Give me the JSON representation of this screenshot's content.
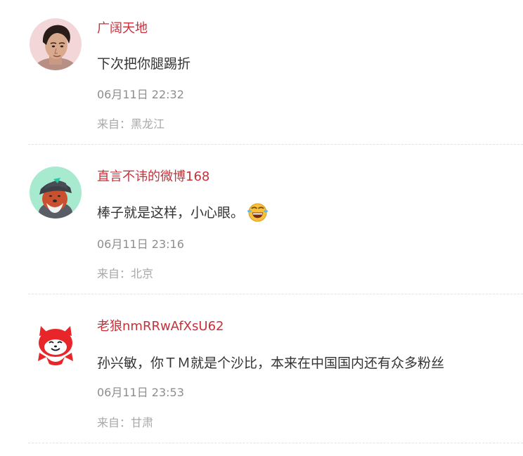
{
  "colors": {
    "username": "#c8303a",
    "content": "#333333",
    "timestamp": "#8d8d8d",
    "location": "#a8a8a8",
    "divider": "#e3e3e3"
  },
  "comments": [
    {
      "username": "广阔天地",
      "content": "下次把你腿踢折",
      "timestamp": "06月11日 22:32",
      "location": "来自：黑龙江",
      "avatar_icon": "male-portrait-avatar"
    },
    {
      "username": "直言不讳的微博168",
      "content": "棒子就是这样，小心眼。",
      "emoji_icon": "laughing-crying-emoji-icon",
      "timestamp": "06月11日 23:16",
      "location": "来自：北京",
      "avatar_icon": "gray-fox-hat-avatar"
    },
    {
      "username": "老狼nmRRwAfXsU62",
      "content": "孙兴敏，你ＴＭ就是个沙比，本来在中国国内还有众多粉丝",
      "timestamp": "06月11日 23:53",
      "location": "来自：甘肃",
      "avatar_icon": "red-fox-avatar"
    }
  ]
}
